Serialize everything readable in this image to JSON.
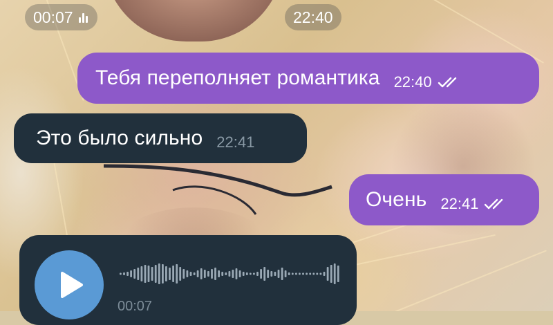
{
  "chat": {
    "top_video_duration": "00:07",
    "top_video_time": "22:40",
    "messages": [
      {
        "direction": "outgoing",
        "text": "Тебя переполняет романтика",
        "time": "22:40",
        "status": "read"
      },
      {
        "direction": "incoming",
        "text": "Это было сильно",
        "time": "22:41"
      },
      {
        "direction": "outgoing",
        "text": "Очень",
        "time": "22:41",
        "status": "read"
      }
    ],
    "voice_message": {
      "direction": "incoming",
      "duration": "00:07",
      "control": "play-icon"
    }
  },
  "colors": {
    "outgoing_bubble": "#8d59c9",
    "incoming_bubble": "#21303c",
    "play_button": "#5a9ad5",
    "incoming_time": "#8a9aa6",
    "waveform": "#9aa9b5"
  }
}
